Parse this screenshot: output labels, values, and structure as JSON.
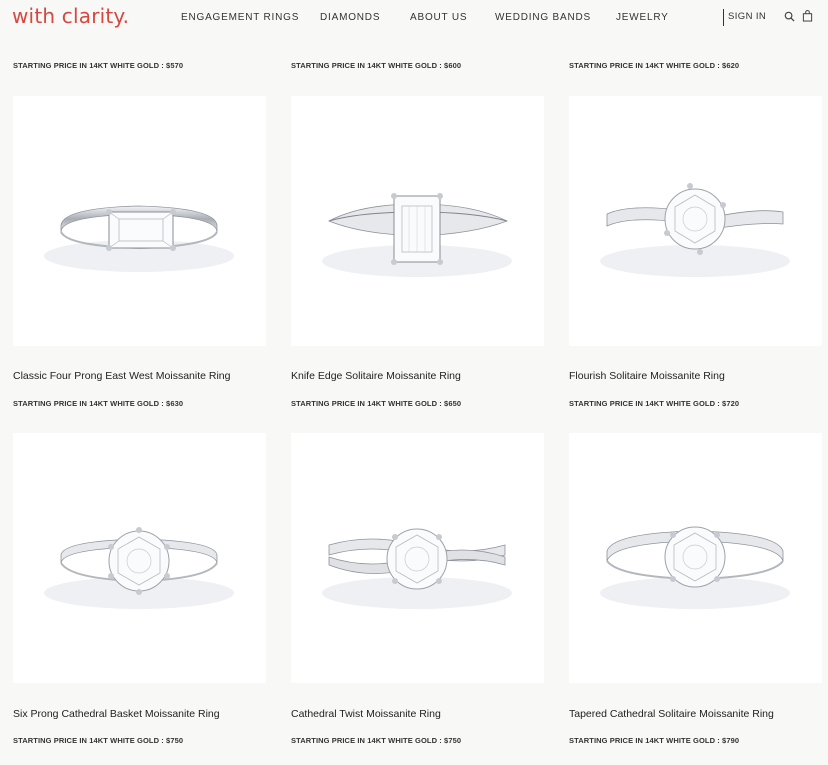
{
  "header": {
    "logo": "with clarity.",
    "nav": [
      "ENGAGEMENT RINGS",
      "DIAMONDS",
      "ABOUT US",
      "WEDDING BANDS",
      "JEWELRY"
    ],
    "sign_in": "SIGN IN",
    "icons": [
      "search-icon",
      "bag-icon"
    ],
    "accent_color": "#d8473f"
  },
  "top_prices": [
    "STARTING PRICE IN 14KT WHITE GOLD : $570",
    "STARTING PRICE IN 14KT WHITE GOLD : $600",
    "STARTING PRICE IN 14KT WHITE GOLD : $620"
  ],
  "products": [
    {
      "name": "Classic Four Prong East West Moissanite Ring",
      "price": "STARTING PRICE IN 14KT WHITE GOLD : $630",
      "image": "east-west-emerald-ring"
    },
    {
      "name": "Knife Edge Solitaire Moissanite Ring",
      "price": "STARTING PRICE IN 14KT WHITE GOLD : $650",
      "image": "knife-edge-emerald-ring"
    },
    {
      "name": "Flourish Solitaire Moissanite Ring",
      "price": "STARTING PRICE IN 14KT WHITE GOLD : $720",
      "image": "flourish-round-ring"
    },
    {
      "name": "Six Prong Cathedral Basket Moissanite Ring",
      "price": "STARTING PRICE IN 14KT WHITE GOLD : $750",
      "image": "six-prong-round-ring"
    },
    {
      "name": "Cathedral Twist Moissanite Ring",
      "price": "STARTING PRICE IN 14KT WHITE GOLD : $750",
      "image": "twist-round-ring"
    },
    {
      "name": "Tapered Cathedral Solitaire Moissanite Ring",
      "price": "STARTING PRICE IN 14KT WHITE GOLD : $790",
      "image": "tapered-round-ring"
    }
  ]
}
